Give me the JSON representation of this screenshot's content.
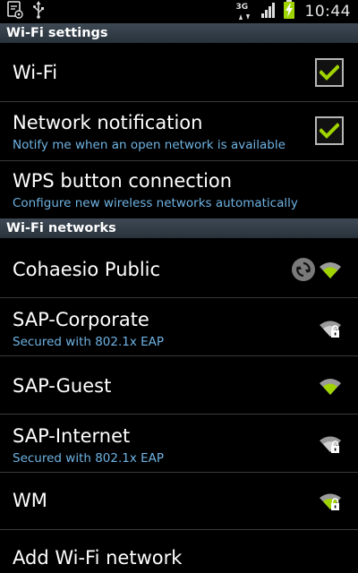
{
  "status_bar": {
    "time": "10:44",
    "network_type": "3G",
    "icons": [
      "settings-notification-icon",
      "usb-icon",
      "data-3g-icon",
      "signal-bars-icon",
      "battery-charging-icon"
    ]
  },
  "sections": {
    "wifi_settings": "Wi-Fi settings",
    "wifi_networks": "Wi-Fi networks"
  },
  "settings": {
    "wifi": {
      "title": "Wi-Fi",
      "checked": true
    },
    "network_notification": {
      "title": "Network notification",
      "subtitle": "Notify me when an open network is available",
      "checked": true
    },
    "wps": {
      "title": "WPS button connection",
      "subtitle": "Configure new wireless networks automatically"
    }
  },
  "networks": [
    {
      "name": "Cohaesio Public",
      "subtitle": "",
      "secured": false,
      "connecting": true
    },
    {
      "name": "SAP-Corporate",
      "subtitle": "Secured with 802.1x EAP",
      "secured": true,
      "connecting": false
    },
    {
      "name": "SAP-Guest",
      "subtitle": "",
      "secured": false,
      "connecting": false
    },
    {
      "name": "SAP-Internet",
      "subtitle": "Secured with 802.1x EAP",
      "secured": true,
      "connecting": false
    },
    {
      "name": "WM",
      "subtitle": "",
      "secured": true,
      "connecting": false
    }
  ],
  "add_network": {
    "title": "Add Wi-Fi network"
  },
  "colors": {
    "accent_green": "#9fd400",
    "subtitle_blue": "#6fb3e3",
    "header_bg": "#34404b"
  }
}
